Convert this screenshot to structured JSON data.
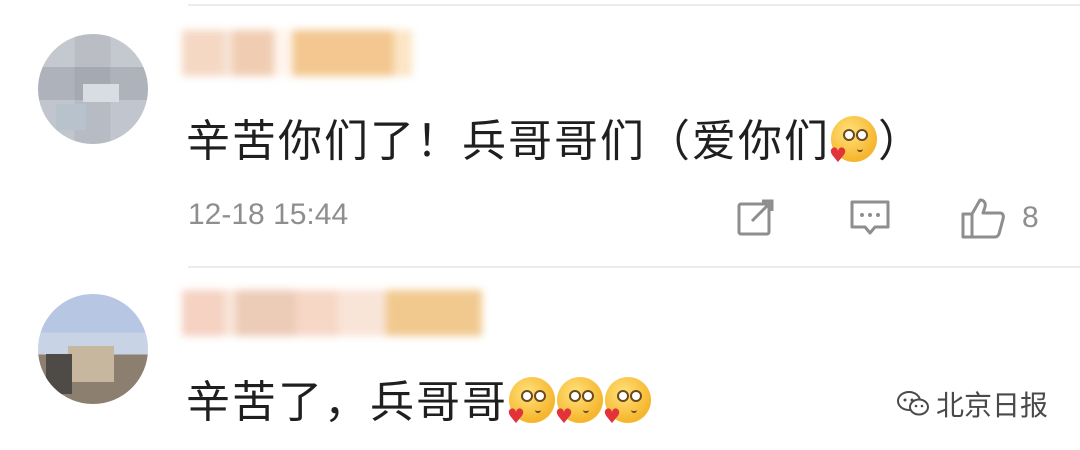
{
  "comments": [
    {
      "text": "辛苦你们了！兵哥哥们（爱你们",
      "text_after_emoji": "）",
      "timestamp": "12-18 15:44",
      "likes": "8"
    },
    {
      "text": "辛苦了，兵哥哥",
      "emoji_count": 3
    }
  ],
  "watermark": {
    "label": "北京日报"
  },
  "icons": [
    "share-icon",
    "reply-icon",
    "like-icon",
    "emoji-love-icon",
    "wechat-icon"
  ]
}
